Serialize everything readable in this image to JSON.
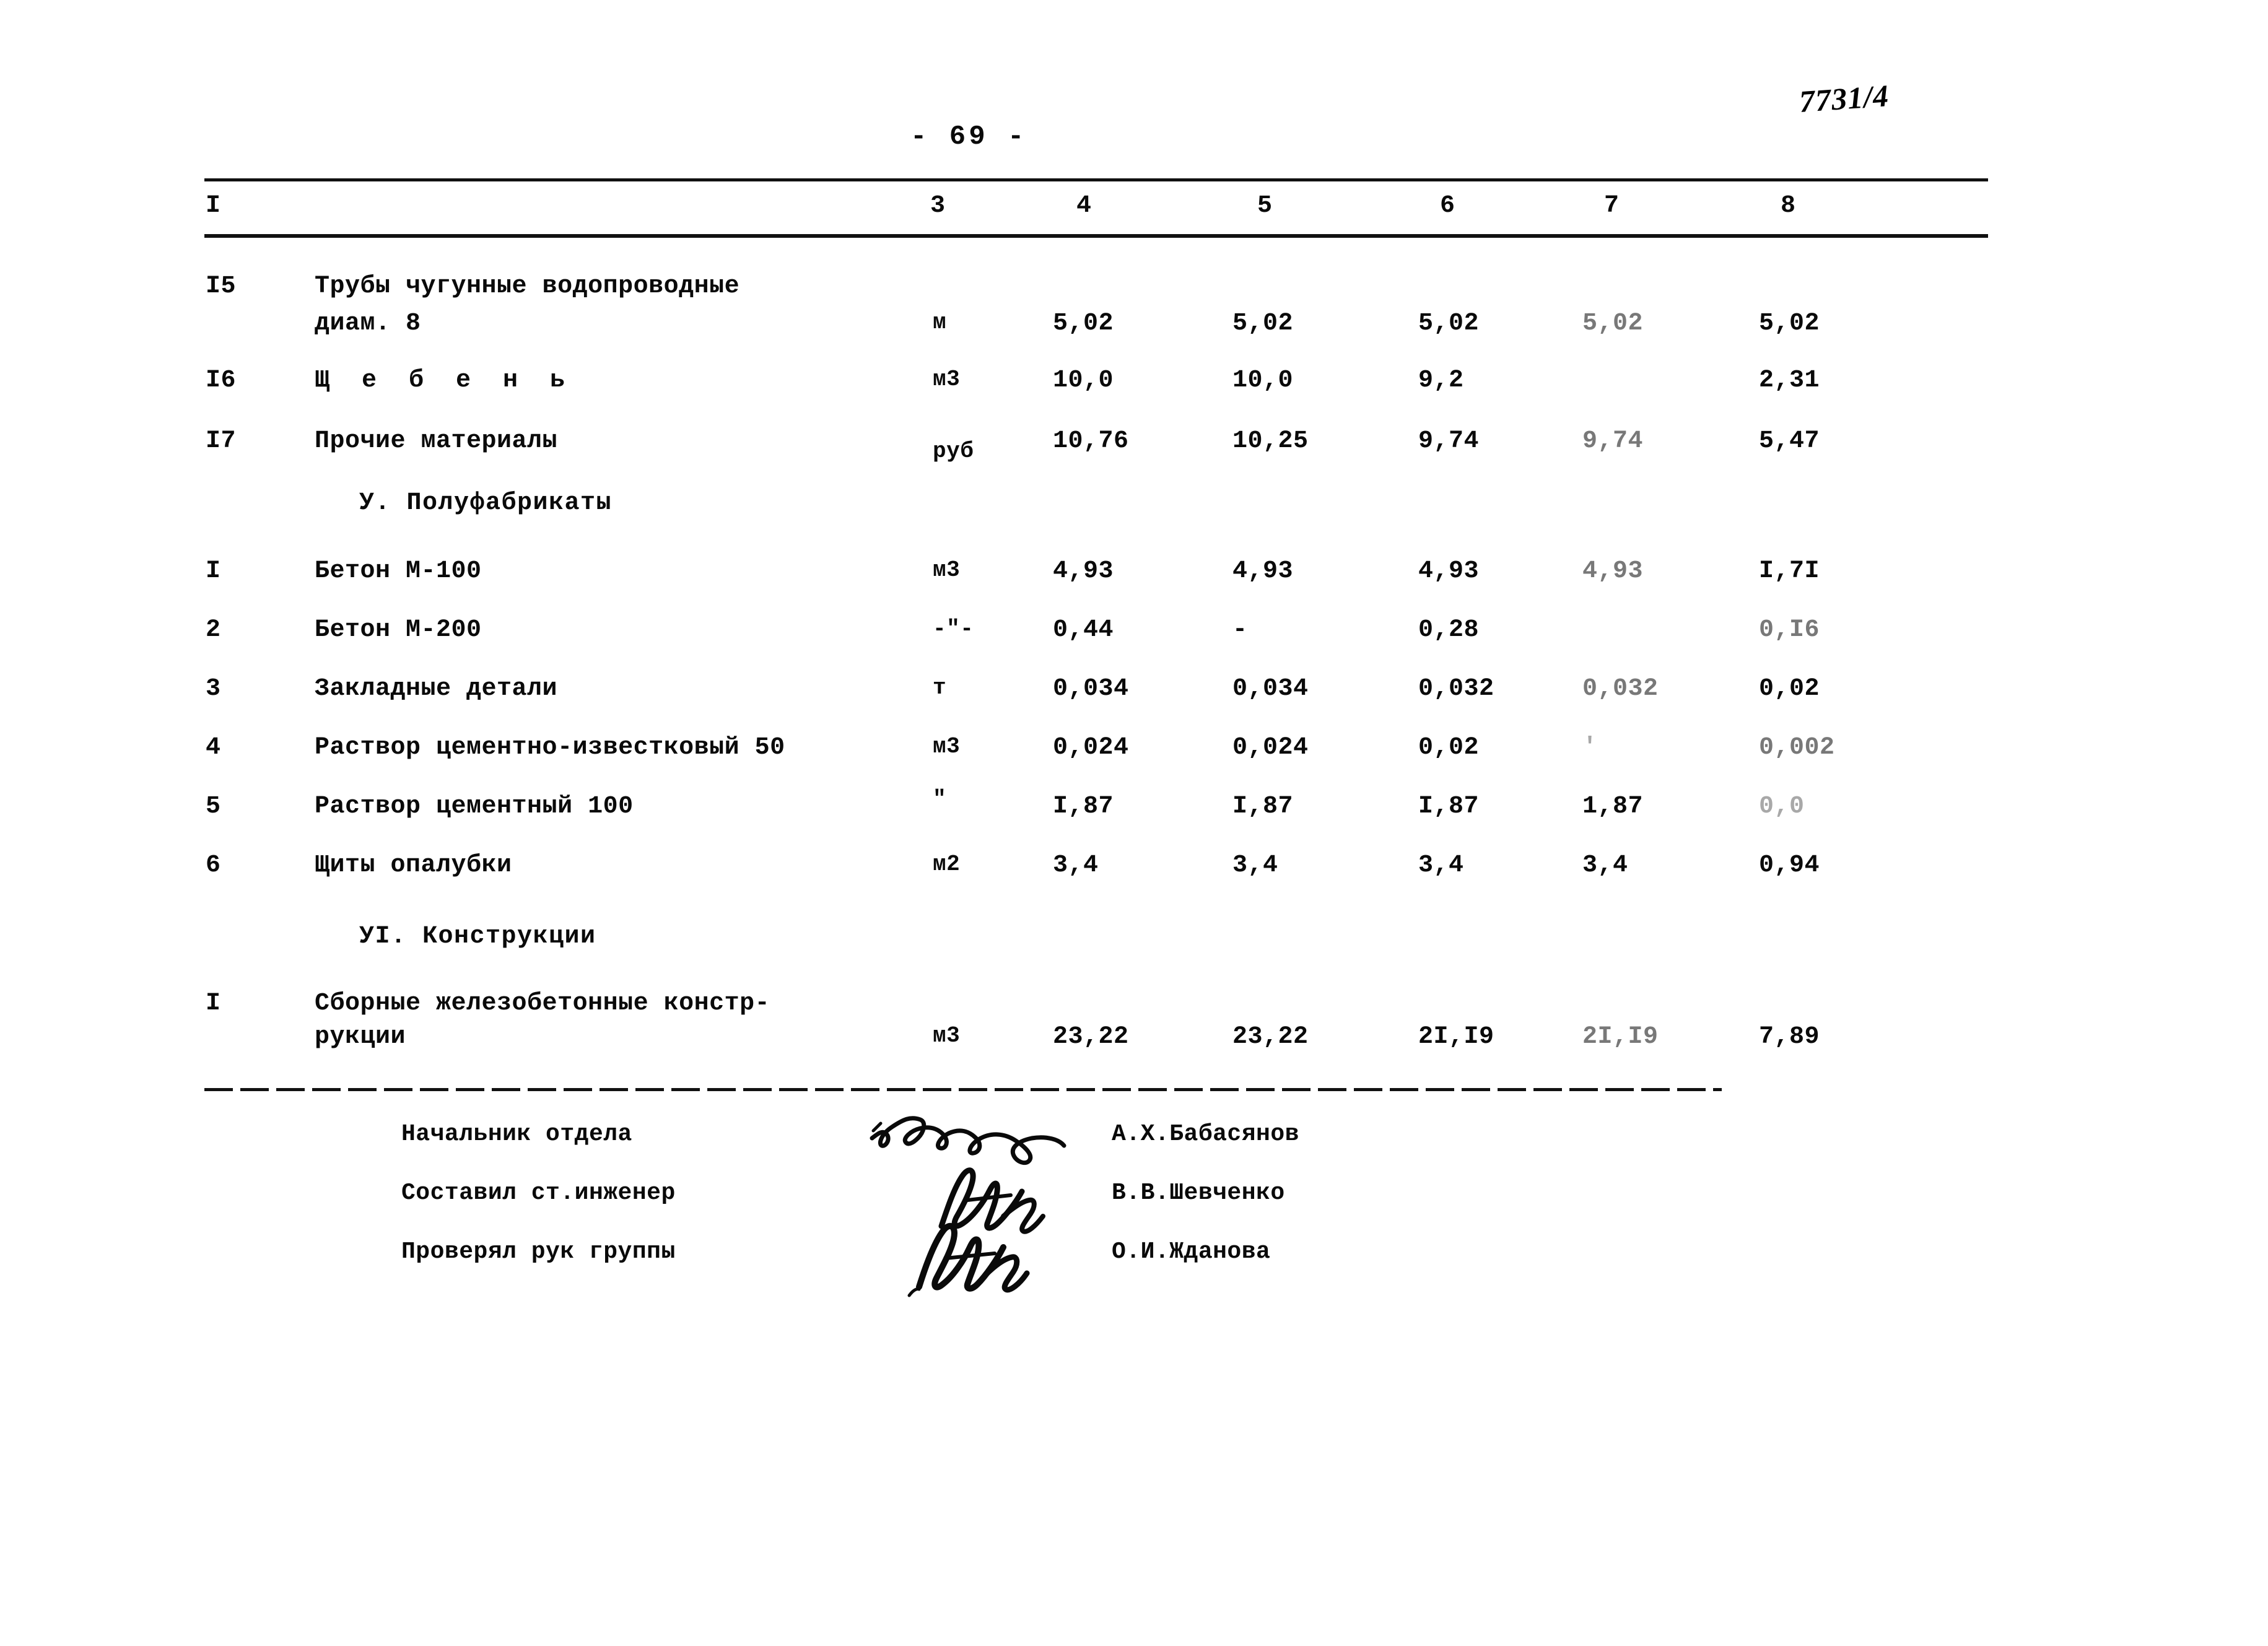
{
  "page": {
    "page_number": "- 69 -",
    "stamp": "7731/4"
  },
  "table": {
    "column_headers": {
      "first": "I",
      "c3": "3",
      "c4": "4",
      "c5": "5",
      "c6": "6",
      "c7": "7",
      "c8": "8"
    },
    "rows": [
      {
        "num": "I5",
        "name": "Трубы чугунные водопроводные",
        "name2": "диам. 8",
        "unit": "м",
        "v3": "5,02",
        "v4": "5,02",
        "v5": "5,02",
        "v6": "5,02",
        "v7": "5,02"
      },
      {
        "num": "I6",
        "name": "Щ е б е н ь",
        "name2": "",
        "unit": "м3",
        "v3": "10,0",
        "v4": "10,0",
        "v5": "9,2",
        "v6": "",
        "v7": "2,31"
      },
      {
        "num": "I7",
        "name": "Прочие материалы",
        "name2": "",
        "unit": "руб",
        "v3": "10,76",
        "v4": "10,25",
        "v5": "9,74",
        "v6": "9,74",
        "v7": "5,47"
      }
    ],
    "section_semis": {
      "title": "У. Полуфабрикаты",
      "rows": [
        {
          "num": "I",
          "name": "Бетон М-100",
          "name2": "",
          "unit": "м3",
          "v3": "4,93",
          "v4": "4,93",
          "v5": "4,93",
          "v6": "4,93",
          "v7": "I,7I"
        },
        {
          "num": "2",
          "name": "Бетон М-200",
          "name2": "",
          "unit": "-\"-",
          "v3": "0,44",
          "v4": "-",
          "v5": "0,28",
          "v6": "",
          "v7": "0,I6"
        },
        {
          "num": "3",
          "name": "Закладные детали",
          "name2": "",
          "unit": "т",
          "v3": "0,034",
          "v4": "0,034",
          "v5": "0,032",
          "v6": "0,032",
          "v7": "0,02"
        },
        {
          "num": "4",
          "name": "Раствор цементно-известковый 50",
          "name2": "",
          "unit": "м3",
          "v3": "0,024",
          "v4": "0,024",
          "v5": "0,02",
          "v6": "'",
          "v7": "0,002"
        },
        {
          "num": "5",
          "name": "Раствор цементный 100",
          "name2": "",
          "unit": "\"",
          "v3": "I,87",
          "v4": "I,87",
          "v5": "I,87",
          "v6": "1,87",
          "v7": "0,0"
        },
        {
          "num": "6",
          "name": "Щиты опалубки",
          "name2": "",
          "unit": "м2",
          "v3": "3,4",
          "v4": "3,4",
          "v5": "3,4",
          "v6": "3,4",
          "v7": "0,94"
        }
      ]
    },
    "section_constructions": {
      "title": "УI. Конструкции",
      "rows": [
        {
          "num": "I",
          "name": "Сборные железобетонные констр-",
          "name2": "рукции",
          "unit": "м3",
          "v3": "23,22",
          "v4": "23,22",
          "v5": "2I,I9",
          "v6": "2I,I9",
          "v7": "7,89"
        }
      ]
    }
  },
  "signatures": [
    {
      "label": "Начальник отдела",
      "name": "А.Х.Бабасянов"
    },
    {
      "label": "Составил ст.инженер",
      "name": "В.В.Шевченко"
    },
    {
      "label": "Проверял рук группы",
      "name": "О.И.Жданова"
    }
  ]
}
